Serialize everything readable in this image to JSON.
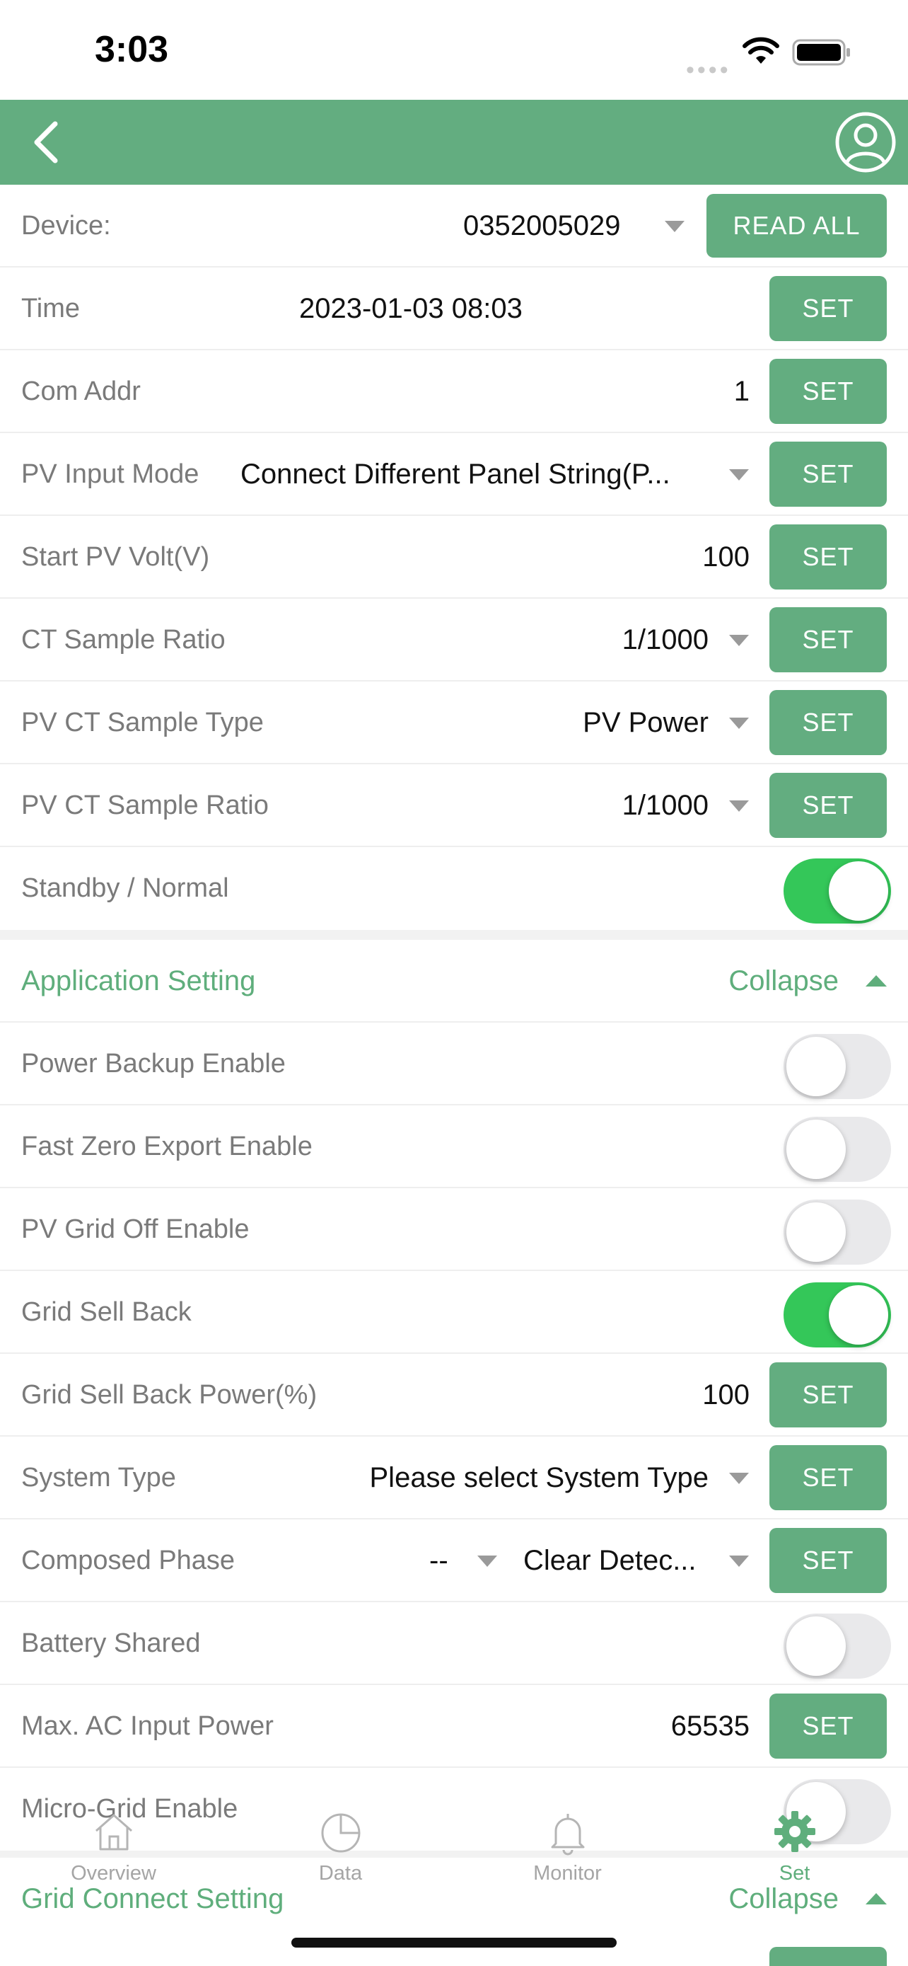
{
  "status_bar": {
    "time": "3:03"
  },
  "device_row": {
    "label": "Device:",
    "value": "0352005029",
    "read_all": "READ ALL"
  },
  "settings": [
    {
      "label": "Time",
      "value": "2023-01-03 08:03",
      "button": "SET"
    },
    {
      "label": "Com Addr",
      "value": "1",
      "button": "SET"
    },
    {
      "label": "PV Input Mode",
      "value": "Connect Different Panel String(P...",
      "button": "SET"
    },
    {
      "label": "Start PV Volt(V)",
      "value": "100",
      "button": "SET"
    },
    {
      "label": "CT Sample Ratio",
      "value": "1/1000",
      "button": "SET"
    },
    {
      "label": "PV CT Sample Type",
      "value": "PV Power",
      "button": "SET"
    },
    {
      "label": "PV CT Sample Ratio",
      "value": "1/1000",
      "button": "SET"
    },
    {
      "label": "Standby / Normal",
      "toggle": true
    }
  ],
  "application_section": {
    "title": "Application Setting",
    "collapse": "Collapse",
    "rows": [
      {
        "label": "Power Backup Enable",
        "toggle": false
      },
      {
        "label": "Fast Zero Export Enable",
        "toggle": false
      },
      {
        "label": "PV Grid Off Enable",
        "toggle": false
      },
      {
        "label": "Grid Sell Back",
        "toggle": true
      },
      {
        "label": "Grid Sell Back Power(%)",
        "value": "100",
        "button": "SET"
      },
      {
        "label": "System Type",
        "value": "Please select System Type",
        "button": "SET"
      },
      {
        "label": "Composed Phase",
        "value_a": "--",
        "value_b": "Clear Detec...",
        "button": "SET"
      },
      {
        "label": "Battery Shared",
        "toggle": false
      },
      {
        "label": "Max. AC Input Power",
        "value": "65535",
        "button": "SET"
      },
      {
        "label": "Micro-Grid Enable",
        "toggle": false
      }
    ]
  },
  "grid_section": {
    "title": "Grid Connect Setting",
    "collapse": "Collapse"
  },
  "tabs": [
    {
      "label": "Overview",
      "icon": "home-icon"
    },
    {
      "label": "Data",
      "icon": "pie-chart-icon"
    },
    {
      "label": "Monitor",
      "icon": "bell-icon"
    },
    {
      "label": "Set",
      "icon": "gear-icon",
      "active": true
    }
  ],
  "colors": {
    "accent": "#63ad80",
    "toggle_on": "#34c759"
  }
}
